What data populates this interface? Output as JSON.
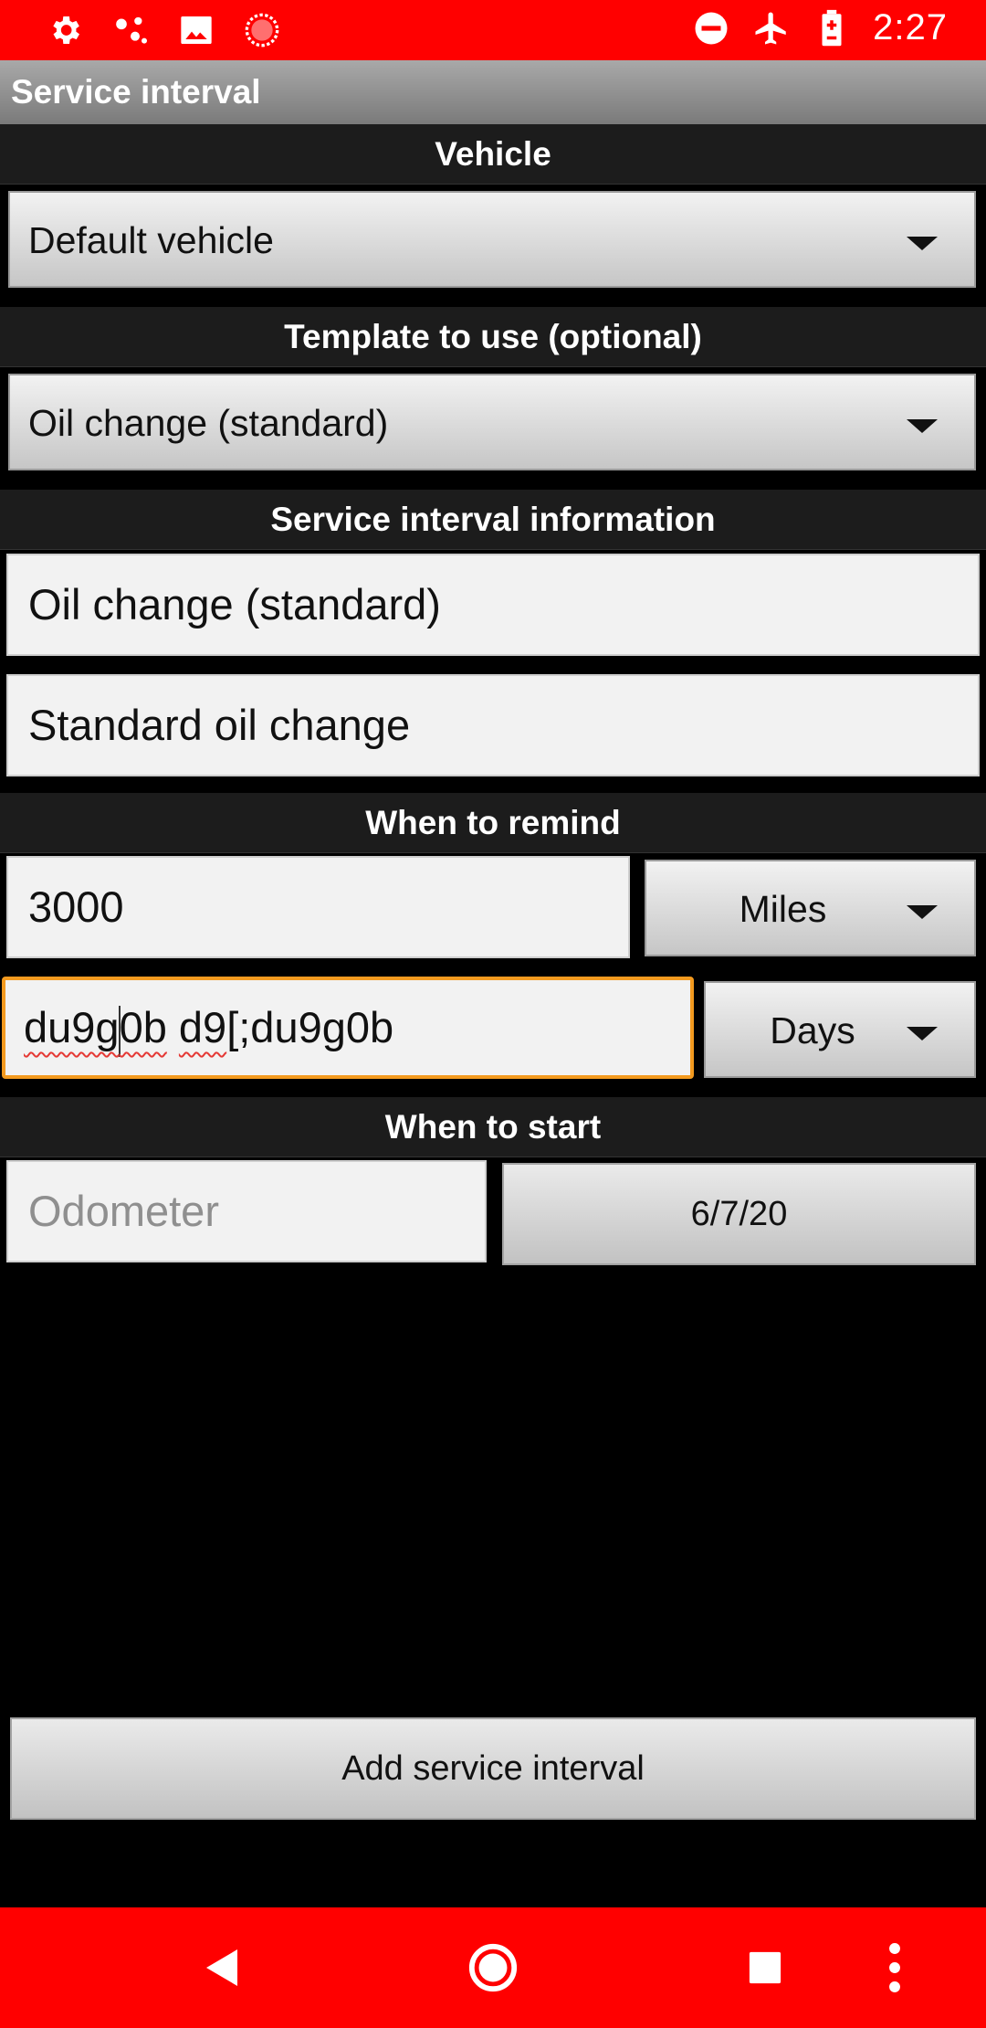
{
  "status_bar": {
    "time": "2:27",
    "left_icons": [
      "gear-icon",
      "share-nodes-icon",
      "image-icon",
      "record-icon"
    ],
    "right_icons": [
      "do-not-disturb-icon",
      "airplane-mode-icon",
      "battery-icon"
    ]
  },
  "app_bar": {
    "title": "Service interval"
  },
  "vehicle": {
    "header": "Vehicle",
    "selected": "Default vehicle"
  },
  "template": {
    "header": "Template to use (optional)",
    "selected": "Oil change (standard)"
  },
  "info": {
    "header": "Service interval information",
    "name_value": "Oil change (standard)",
    "description_value": "Standard oil change"
  },
  "remind": {
    "header": "When to remind",
    "distance_value": "3000",
    "distance_unit": "Miles",
    "time_value_part1": "du9g",
    "time_value_part2": "0b",
    "time_value_part3": "d9",
    "time_value_part4": "[;du9g0b",
    "time_unit": "Days"
  },
  "start": {
    "header": "When to start",
    "odometer_placeholder": "Odometer",
    "date_value": "6/7/20"
  },
  "actions": {
    "add_label": "Add service interval"
  },
  "colors": {
    "status_bar": "#ff0000",
    "nav_bar": "#ff0000",
    "focus_border": "#f39a1f",
    "background": "#000000"
  }
}
